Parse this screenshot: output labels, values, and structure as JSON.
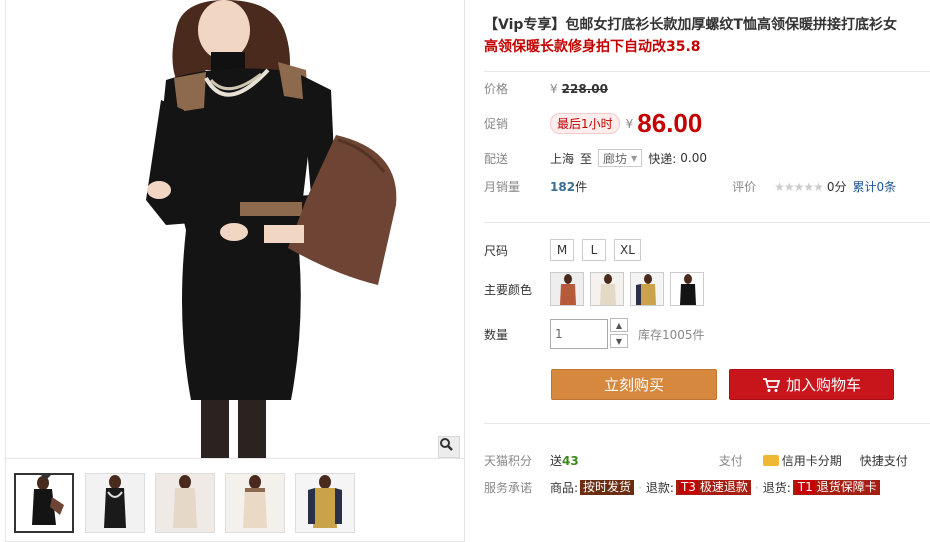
{
  "product": {
    "title": "【Vip专享】包邮女打底衫长款加厚螺纹T恤高领保暖拼接打底衫女",
    "subtitle": "高领保暖长款修身拍下自动改35.8"
  },
  "price": {
    "label": "价格",
    "currency": "¥",
    "original": "228.00"
  },
  "promo": {
    "label": "促销",
    "tag": "最后1小时",
    "currency": "¥",
    "price": "86.00"
  },
  "shipping": {
    "label": "配送",
    "from": "上海",
    "to_word": "至",
    "destination": "廊坊",
    "fee_label": "快递:",
    "fee": "0.00"
  },
  "sales": {
    "label": "月销量",
    "count": "182",
    "unit": "件",
    "review_label": "评价",
    "stars": "★★★★★",
    "score": "0分",
    "total": "累计0条"
  },
  "sizes": {
    "label": "尺码",
    "options": [
      "M",
      "L",
      "XL"
    ]
  },
  "colors": {
    "label": "主要颜色",
    "swatches": [
      "rust-top",
      "beige-top",
      "camel-top",
      "black-dress"
    ]
  },
  "quantity": {
    "label": "数量",
    "value": "1",
    "up": "▲",
    "down": "▼",
    "stock": "库存1005件"
  },
  "actions": {
    "buy": "立刻购买",
    "cart": "加入购物车"
  },
  "points": {
    "label": "天猫积分",
    "give": "送",
    "value": "43",
    "pay_label": "支付",
    "installment": "信用卡分期",
    "quick_pay": "快捷支付"
  },
  "service": {
    "label": "服务承诺",
    "goods_label": "商品:",
    "goods_tag": "按时发货",
    "refund_label": "退款:",
    "refund_code": "T3",
    "refund_tag": "极速退款",
    "return_label": "退货:",
    "return_code": "T1",
    "return_tag": "退货保障卡",
    "dot": "·"
  },
  "colors_theme": {
    "accent_red": "#c40000",
    "buy_orange": "#d6893e",
    "cart_red": "#c8151c"
  }
}
